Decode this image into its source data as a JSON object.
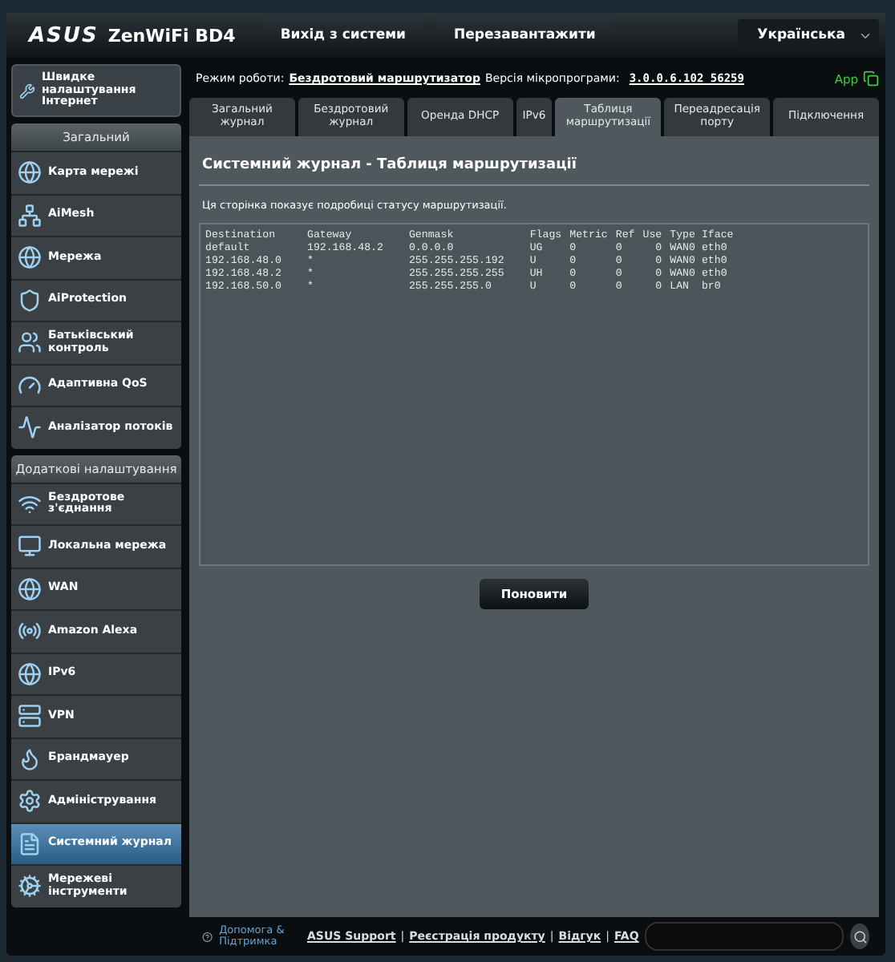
{
  "header": {
    "logo": "ASUS",
    "model": "ZenWiFi BD4",
    "buttons": [
      "Вихід з системи",
      "Перезавантажити"
    ],
    "language": "Українська"
  },
  "status": {
    "mode_label": "Режим роботи:",
    "mode": "Бездротовий маршрутизатор",
    "firmware_label": "Версія мікропрограми:",
    "firmware": "3.0.0.6.102_56259",
    "app": "App"
  },
  "sidebar": {
    "quick_setup": "Швидке налаштування Інтернет",
    "sections": [
      {
        "title": "Загальний",
        "items": [
          {
            "label": "Карта мережі",
            "selected": false
          },
          {
            "label": "AiMesh",
            "selected": false
          },
          {
            "label": "Мережа",
            "selected": false
          },
          {
            "label": "AiProtection",
            "selected": false
          },
          {
            "label": "Батьківський контроль",
            "selected": false
          },
          {
            "label": "Адаптивна QoS",
            "selected": false
          },
          {
            "label": "Аналізатор потоків",
            "selected": false
          }
        ]
      },
      {
        "title": "Додаткові налаштування",
        "items": [
          {
            "label": "Бездротове з'єднання",
            "selected": false
          },
          {
            "label": "Локальна мережа",
            "selected": false
          },
          {
            "label": "WAN",
            "selected": false
          },
          {
            "label": "Amazon Alexa",
            "selected": false
          },
          {
            "label": "IPv6",
            "selected": false
          },
          {
            "label": "VPN",
            "selected": false
          },
          {
            "label": "Брандмауер",
            "selected": false
          },
          {
            "label": "Адміністрування",
            "selected": false
          },
          {
            "label": "Системний журнал",
            "selected": true
          },
          {
            "label": "Мережеві інструменти",
            "selected": false
          }
        ]
      }
    ]
  },
  "tabs": [
    {
      "label": "Загальний журнал",
      "selected": false
    },
    {
      "label": "Бездротовий журнал",
      "selected": false
    },
    {
      "label": "Оренда DHCP",
      "selected": false
    },
    {
      "label": "IPv6",
      "selected": false
    },
    {
      "label": "Таблиця маршрутизації",
      "selected": true
    },
    {
      "label": "Переадресація порту",
      "selected": false
    },
    {
      "label": "Підключення",
      "selected": false
    }
  ],
  "panel": {
    "title": "Системний журнал - Таблиця маршрутизації",
    "description": "Ця сторінка показує подробиці статусу маршрутизації.",
    "table": {
      "columns": [
        "Destination",
        "Gateway",
        "Genmask",
        "Flags",
        "Metric",
        "Ref",
        "Use",
        "Type",
        "Iface"
      ],
      "rows": [
        [
          "default",
          "192.168.48.2",
          "0.0.0.0",
          "UG",
          "0",
          "0",
          "0",
          "WAN0",
          "eth0"
        ],
        [
          "192.168.48.0",
          "*",
          "255.255.255.192",
          "U",
          "0",
          "0",
          "0",
          "WAN0",
          "eth0"
        ],
        [
          "192.168.48.2",
          "*",
          "255.255.255.255",
          "UH",
          "0",
          "0",
          "0",
          "WAN0",
          "eth0"
        ],
        [
          "192.168.50.0",
          "*",
          "255.255.255.0",
          "U",
          "0",
          "0",
          "0",
          "LAN",
          "br0"
        ]
      ]
    },
    "button": "Поновити"
  },
  "footer": {
    "help": "Допомога & Підтримка",
    "links": [
      "ASUS Support",
      "Реєстрація продукту",
      "Відгук",
      "FAQ"
    ],
    "separator": "|"
  }
}
